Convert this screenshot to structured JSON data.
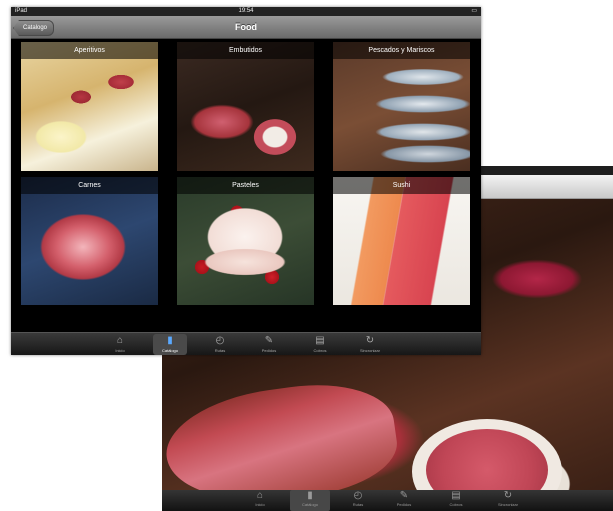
{
  "front": {
    "status": {
      "device": "iPad",
      "time": "19:54"
    },
    "navbar": {
      "back_label": "Catalogo",
      "title": "Food"
    },
    "tiles": [
      {
        "label": "Aperitivos"
      },
      {
        "label": "Embutidos"
      },
      {
        "label": "Pescados y Mariscos"
      },
      {
        "label": "Carnes"
      },
      {
        "label": "Pasteles"
      },
      {
        "label": "Sushi"
      }
    ],
    "tabs": [
      {
        "label": "Inicio",
        "icon": "home-icon"
      },
      {
        "label": "Catálogo",
        "icon": "catalog-icon",
        "selected": true
      },
      {
        "label": "Rutas",
        "icon": "routes-icon"
      },
      {
        "label": "Pedidos",
        "icon": "orders-icon"
      },
      {
        "label": "Cobros",
        "icon": "payments-icon"
      },
      {
        "label": "Sincronizar",
        "icon": "sync-icon"
      }
    ]
  },
  "back": {
    "tabs": [
      {
        "label": "Inicio"
      },
      {
        "label": "Catálogo"
      },
      {
        "label": "Rutas"
      },
      {
        "label": "Pedidos"
      },
      {
        "label": "Cobros"
      },
      {
        "label": "Sincronizar"
      }
    ]
  }
}
